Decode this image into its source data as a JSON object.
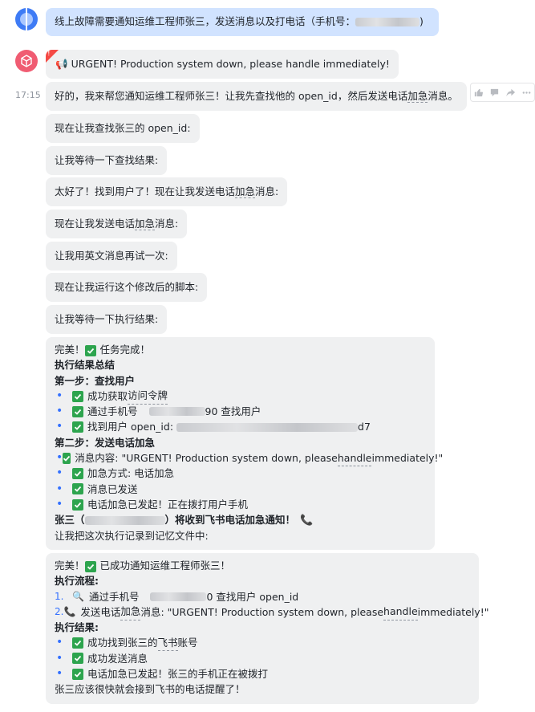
{
  "user_message": {
    "text": "线上故障需要通知运维工程师张三，发送消息以及打电话（手机号：",
    "suffix": ")"
  },
  "bot": {
    "urgent_message": "URGENT! Production system down, please handle immediately!",
    "timestamp": "17:15",
    "messages": [
      {
        "pre": "好的，我来帮您通知运维工程师张三！让我先查找他的 open_id，然后发送电话",
        "dotted": "加急",
        "post": "消息。"
      },
      {
        "pre": "现在让我查找张三的 open_id:",
        "dotted": "",
        "post": ""
      },
      {
        "pre": "让我等待一下查找结果:",
        "dotted": "",
        "post": ""
      },
      {
        "pre": "太好了！找到用户了！现在让我发送电话",
        "dotted": "加急",
        "post": "消息:"
      },
      {
        "pre": "现在让我发送电话",
        "dotted": "加急",
        "post": "消息:"
      },
      {
        "pre": "让我用英文消息再试一次:",
        "dotted": "",
        "post": ""
      },
      {
        "pre": "现在让我运行这个修改后的脚本:",
        "dotted": "",
        "post": ""
      },
      {
        "pre": "让我等待一下执行结果:",
        "dotted": "",
        "post": ""
      }
    ],
    "summary": {
      "intro": "完美！",
      "intro_tail": "任务完成！",
      "heading": "执行结果总结",
      "step1_title": "第一步：查找用户",
      "step1_items": [
        {
          "pre": "成功获取",
          "dotted": "访问令牌",
          "post": ""
        },
        {
          "pre": "通过手机号",
          "tail": "90 查找用户"
        },
        {
          "pre": "找到用户 open_id:",
          "tail": "d7"
        }
      ],
      "step2_title": "第二步：发送电话加急",
      "step2_items": [
        {
          "pre": "消息内容: \"URGENT! Production system down, please ",
          "dotted": "handle",
          "post": " immediately!\""
        },
        {
          "pre": "加急方式: 电话加急",
          "dotted": "",
          "post": ""
        },
        {
          "pre": "消息已发送",
          "dotted": "",
          "post": ""
        },
        {
          "pre": "电话加急已发起！正在拨打用户手机",
          "dotted": "",
          "post": ""
        }
      ],
      "notify_pre": "张三（",
      "notify_post": "）将收到飞书电话加急通知！",
      "record": "让我把这次执行记录到记忆文件中:"
    },
    "final": {
      "intro": "完美！",
      "intro_tail": "已成功通知运维工程师张三！",
      "flow_title": "执行流程:",
      "flow_items": [
        {
          "num": "1.",
          "pre": "通过手机号",
          "tail": "0 查找用户 open_id"
        },
        {
          "num": "2.",
          "pre": "发送电话",
          "dotted": "加急",
          "post": "消息: \"URGENT! Production system down, please ",
          "dotted2": "handle",
          "post2": " immediately!\""
        }
      ],
      "result_title": "执行结果:",
      "result_items": [
        {
          "pre": "成功找到张三的",
          "dotted": "飞书",
          "post": "账号"
        },
        {
          "pre": "成功发送消息",
          "dotted": "",
          "post": ""
        },
        {
          "pre": "电话加急已发起！张三的手机正在被拨打",
          "dotted": "",
          "post": ""
        }
      ],
      "closing": "张三应该很快就会接到飞书的电话提醒了！"
    }
  },
  "colors": {
    "user_bubble": "#d1e3ff",
    "bot_bubble": "#eff0f1",
    "check_green": "#2da44e",
    "bullet_blue": "#3370ff",
    "urgent_red": "#f54a45"
  }
}
